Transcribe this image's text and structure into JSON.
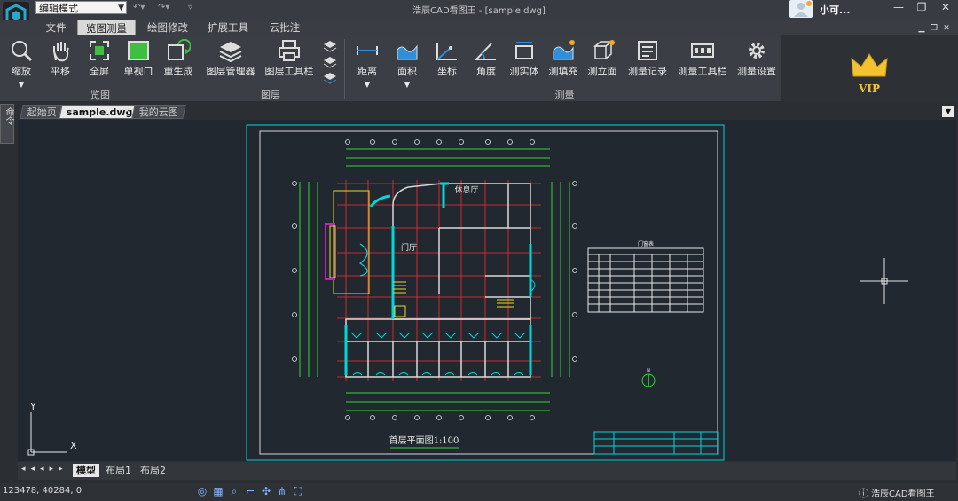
{
  "app": {
    "title": "浩辰CAD看图王 - [sample.dwg]",
    "mode": "编辑模式",
    "user_name": "小可...",
    "status_app_name": "浩辰CAD看图王"
  },
  "menu": [
    "文件",
    "览图测量",
    "绘图修改",
    "扩展工具",
    "云批注"
  ],
  "ribbon": {
    "view_group": {
      "label": "览图",
      "buttons": [
        "缩放",
        "平移",
        "全屏",
        "单视口",
        "重生成"
      ]
    },
    "layer_group": {
      "label": "图层",
      "buttons": [
        "图层管理器",
        "图层工具栏"
      ]
    },
    "measure_group": {
      "label": "测量",
      "buttons": [
        "距离",
        "面积",
        "坐标",
        "角度",
        "测实体",
        "测填充",
        "测立面",
        "测量记录",
        "测量工具栏",
        "测量设置"
      ]
    },
    "vip_label": "VIP"
  },
  "doc_tabs": [
    "起始页",
    "sample.dwg",
    "我的云图"
  ],
  "side_tab": "命令",
  "layout_tabs": [
    "模型",
    "布局1",
    "布局2"
  ],
  "status": {
    "coordinates": "123478, 40284, 0"
  },
  "drawing": {
    "plan_title": "首层平面图1:100",
    "room_labels": [
      "休息厅",
      "门厅"
    ],
    "table_title": "门窗表"
  },
  "colors": {
    "accent": "#2f8fd8",
    "canvas": "#212830",
    "frame": "#00d8d8",
    "grid": "#ff2b2b",
    "wall": "#d8d8d8"
  }
}
